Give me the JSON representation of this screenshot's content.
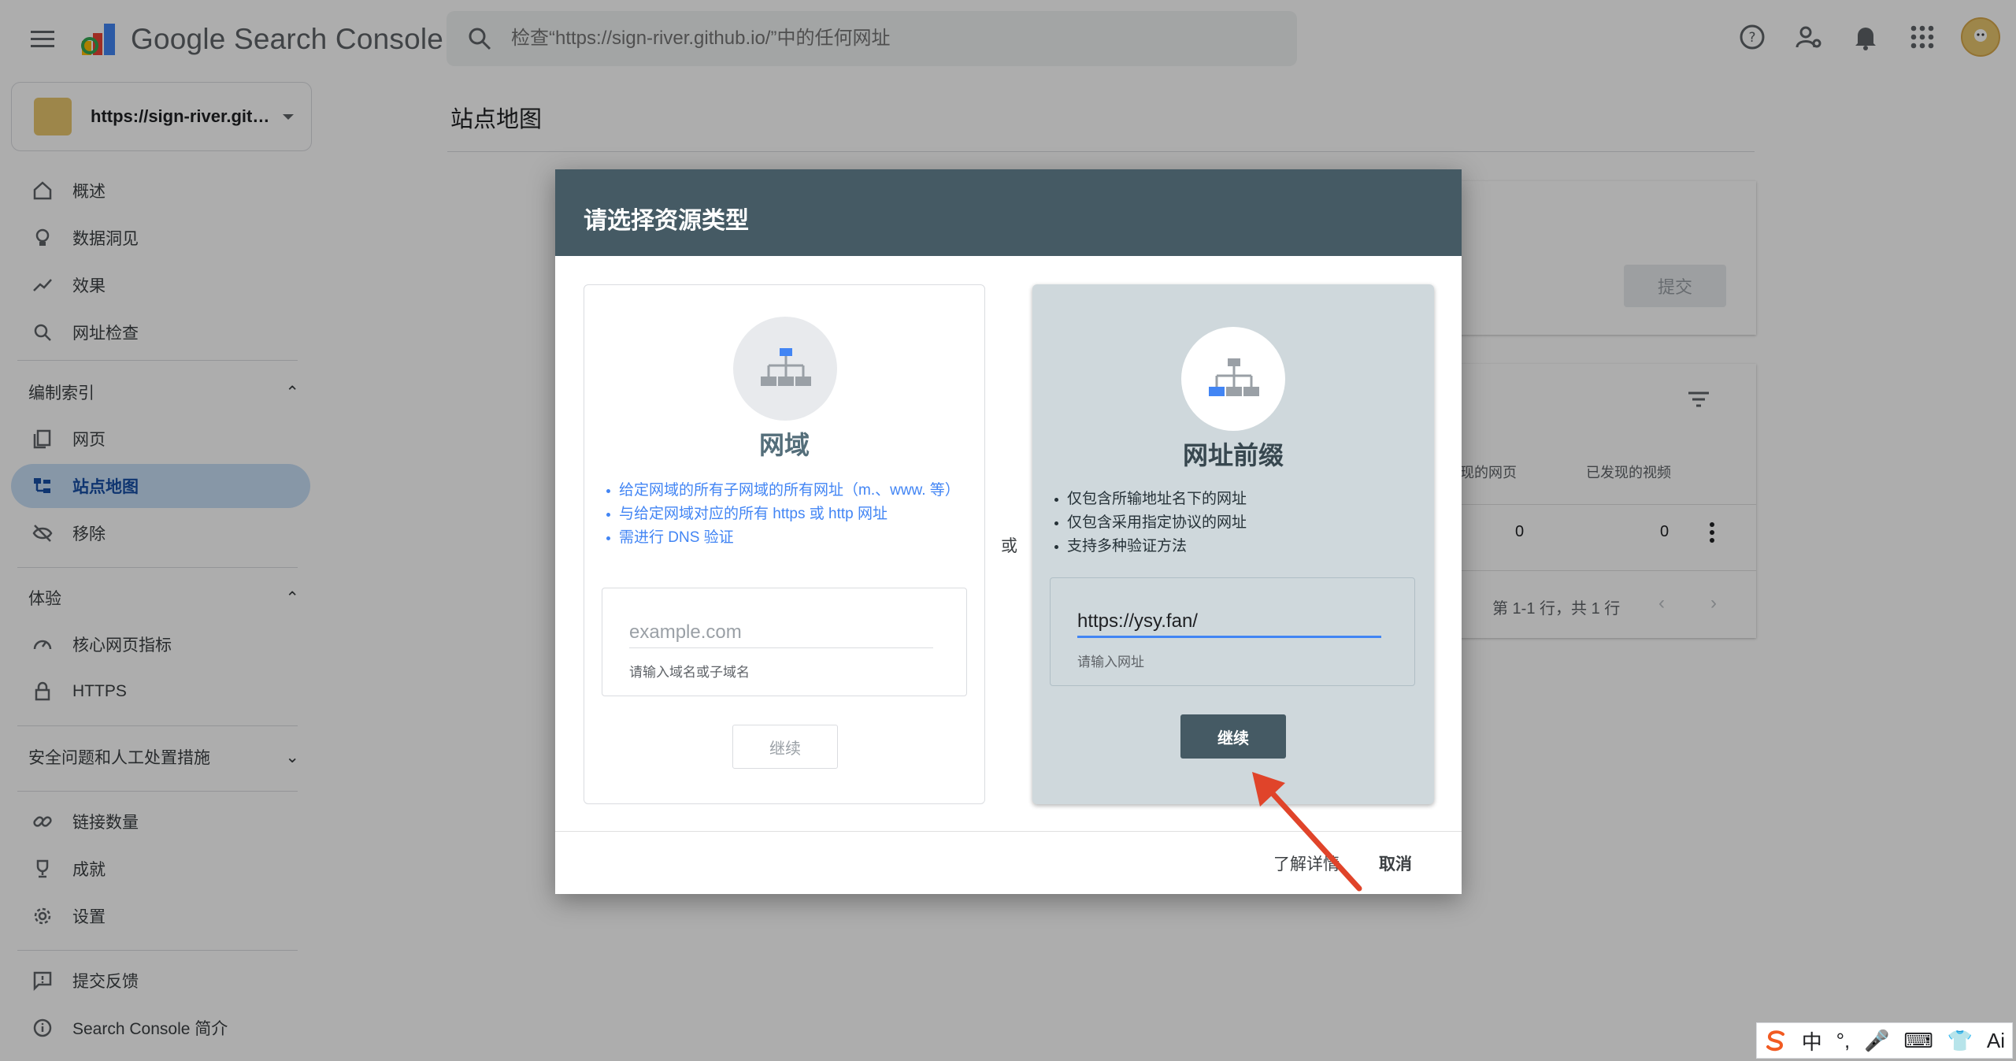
{
  "header": {
    "app_name": "Google Search Console",
    "search_placeholder": "检查“https://sign-river.github.io/”中的任何网址"
  },
  "sidebar": {
    "property": "https://sign-river.gith...",
    "items_main": [
      {
        "label": "概述"
      },
      {
        "label": "数据洞见"
      },
      {
        "label": "效果"
      },
      {
        "label": "网址检查"
      }
    ],
    "section_index": "编制索引",
    "items_index": [
      {
        "label": "网页"
      },
      {
        "label": "站点地图"
      },
      {
        "label": "移除"
      }
    ],
    "section_experience": "体验",
    "items_experience": [
      {
        "label": "核心网页指标"
      },
      {
        "label": "HTTPS"
      }
    ],
    "section_security": "安全问题和人工处置措施",
    "items_other": [
      {
        "label": "链接数量"
      },
      {
        "label": "成就"
      },
      {
        "label": "设置"
      }
    ],
    "items_footer": [
      {
        "label": "提交反馈"
      },
      {
        "label": "Search Console 简介"
      }
    ]
  },
  "page": {
    "title": "站点地图",
    "submit_label": "提交",
    "col_pages": "发现的网页",
    "col_videos": "已发现的视频",
    "row_pages": "0",
    "row_videos": "0",
    "pagination": "第 1-1 行，共 1 行"
  },
  "dialog": {
    "title": "请选择资源类型",
    "or_label": "或",
    "domain": {
      "title": "网域",
      "bullets": [
        "给定网域的所有子网域的所有网址（m.、www. 等）",
        "与给定网域对应的所有 https 或 http 网址",
        "需进行 DNS 验证"
      ],
      "placeholder": "example.com",
      "help": "请输入域名或子域名",
      "continue": "继续"
    },
    "prefix": {
      "title": "网址前缀",
      "bullets": [
        "仅包含所输地址名下的网址",
        "仅包含采用指定协议的网址",
        "支持多种验证方法"
      ],
      "value": "https://ysy.fan/",
      "help": "请输入网址",
      "continue": "继续"
    },
    "learn_more": "了解详情",
    "cancel": "取消"
  },
  "ime": {
    "items": [
      "中",
      "°,",
      "🎤",
      "⌨",
      "👕",
      "Ai"
    ]
  },
  "colors": {
    "dialog_header": "#455a64",
    "selected_card": "#cfd8dc",
    "active_nav": "#c7dff7",
    "accent": "#4285f4",
    "annotation_arrow": "#e0442a"
  }
}
